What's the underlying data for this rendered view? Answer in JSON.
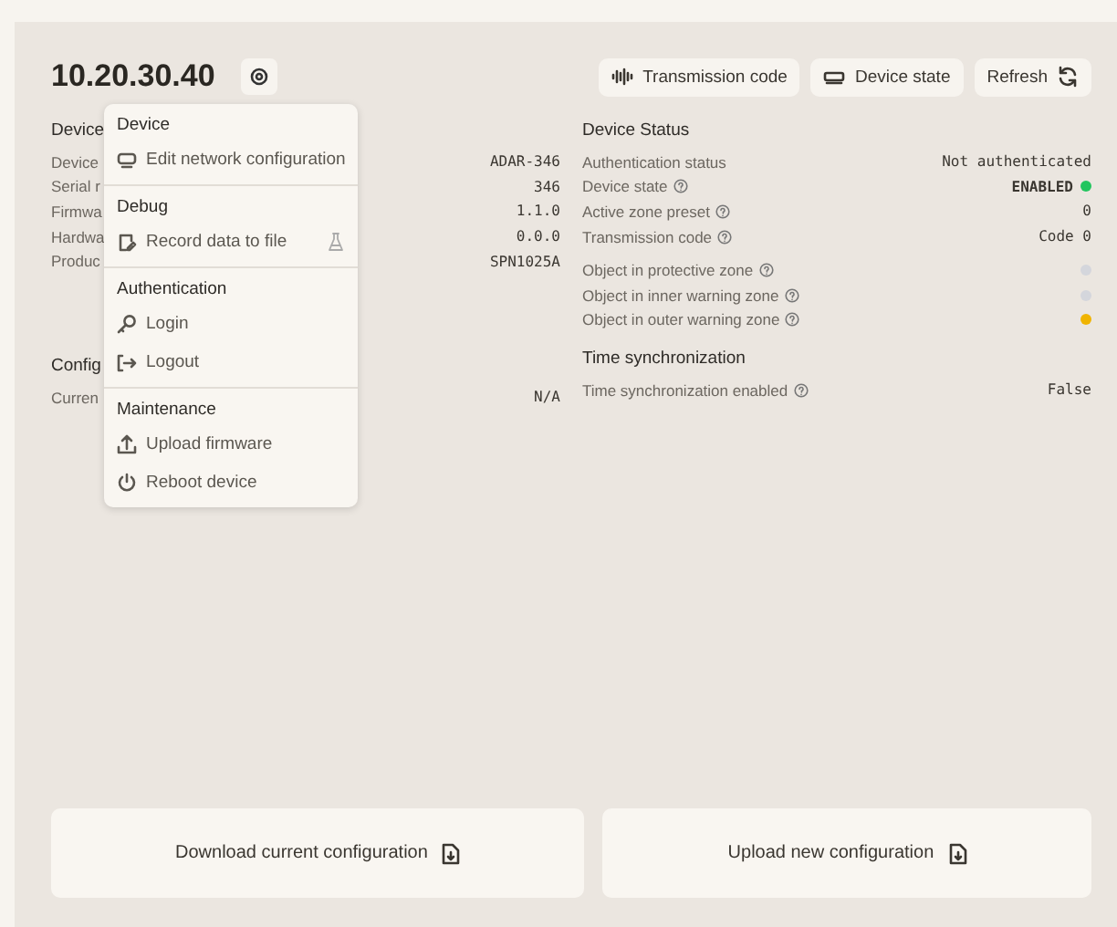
{
  "header": {
    "title": "10.20.30.40",
    "buttons": [
      {
        "kind": "code",
        "label": "Transmission code"
      },
      {
        "kind": "state",
        "label": "Device state"
      },
      {
        "kind": "refresh",
        "label": "Refresh"
      }
    ]
  },
  "left_sections": [
    {
      "heading": "Device",
      "rows": [
        {
          "label": "Device",
          "value": "ADAR-346"
        },
        {
          "label": "Serial r",
          "value": "346"
        },
        {
          "label": "Firmwa",
          "value": "1.1.0"
        },
        {
          "label": "Hardwa",
          "value": "0.0.0"
        },
        {
          "label": "Produc",
          "value": "SPN1025A"
        }
      ]
    },
    {
      "heading": "Config",
      "rows": [
        {
          "label": "Curren",
          "value": "N/A"
        }
      ]
    }
  ],
  "right_sections": [
    {
      "heading": "Device Status",
      "groups": [
        [
          {
            "label": "Authentication status",
            "help": false,
            "value": "Not authenticated",
            "bold": false
          },
          {
            "label": "Device state",
            "help": true,
            "value": "ENABLED",
            "bold": true,
            "color": "#22c55e"
          },
          {
            "label": "Active zone preset",
            "help": true,
            "value": "0",
            "bold": false
          },
          {
            "label": "Transmission code",
            "help": true,
            "value": "Code 0",
            "bold": false
          }
        ],
        [
          {
            "label": "Object in protective zone",
            "help": true,
            "color": "#d4d6dc"
          },
          {
            "label": "Object in inner warning zone",
            "help": true,
            "color": "#d4d6dc"
          },
          {
            "label": "Object in outer warning zone",
            "help": true,
            "color": "#f0b400"
          }
        ]
      ]
    },
    {
      "heading": "Time synchronization",
      "groups": [
        [
          {
            "label": "Time synchronization enabled",
            "help": true,
            "value": "False",
            "bold": false
          }
        ]
      ]
    }
  ],
  "menu": [
    {
      "heading": "Device",
      "items": [
        {
          "kind": "network",
          "label": "Edit network configuration",
          "experimental": false
        }
      ]
    },
    {
      "heading": "Debug",
      "items": [
        {
          "kind": "record",
          "label": "Record data to file",
          "experimental": true
        }
      ]
    },
    {
      "heading": "Authentication",
      "items": [
        {
          "kind": "login",
          "label": "Login",
          "experimental": false
        },
        {
          "kind": "logout",
          "label": "Logout",
          "experimental": false
        }
      ]
    },
    {
      "heading": "Maintenance",
      "items": [
        {
          "kind": "upload",
          "label": "Upload firmware",
          "experimental": false
        },
        {
          "kind": "reboot",
          "label": "Reboot device",
          "experimental": false
        }
      ]
    }
  ],
  "actions": [
    {
      "label": "Download current configuration"
    },
    {
      "label": "Upload new configuration"
    }
  ]
}
